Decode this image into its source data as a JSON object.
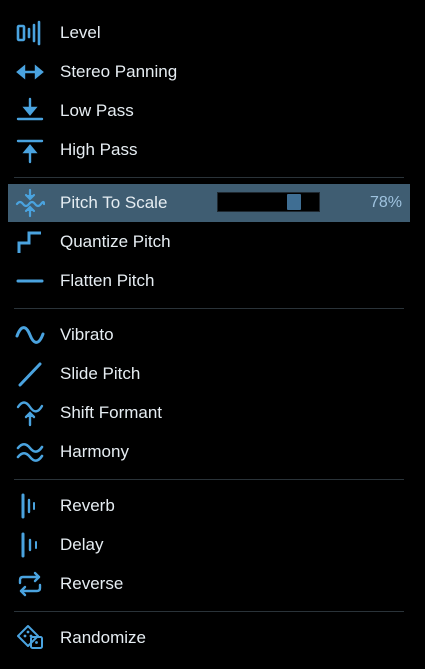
{
  "menu": {
    "accent": "#4aa3df",
    "items": [
      {
        "label": "Level",
        "icon": "level-icon"
      },
      {
        "label": "Stereo Panning",
        "icon": "stereo-panning-icon"
      },
      {
        "label": "Low Pass",
        "icon": "low-pass-icon"
      },
      {
        "label": "High Pass",
        "icon": "high-pass-icon"
      },
      {
        "label": "Pitch To Scale",
        "icon": "pitch-to-scale-icon",
        "selected": true,
        "slider_value": 0.78,
        "value_text": "78%"
      },
      {
        "label": "Quantize Pitch",
        "icon": "quantize-pitch-icon"
      },
      {
        "label": "Flatten Pitch",
        "icon": "flatten-pitch-icon"
      },
      {
        "label": "Vibrato",
        "icon": "vibrato-icon"
      },
      {
        "label": "Slide Pitch",
        "icon": "slide-pitch-icon"
      },
      {
        "label": "Shift Formant",
        "icon": "shift-formant-icon"
      },
      {
        "label": "Harmony",
        "icon": "harmony-icon"
      },
      {
        "label": "Reverb",
        "icon": "reverb-icon"
      },
      {
        "label": "Delay",
        "icon": "delay-icon"
      },
      {
        "label": "Reverse",
        "icon": "reverse-icon"
      },
      {
        "label": "Randomize",
        "icon": "randomize-icon"
      }
    ]
  }
}
